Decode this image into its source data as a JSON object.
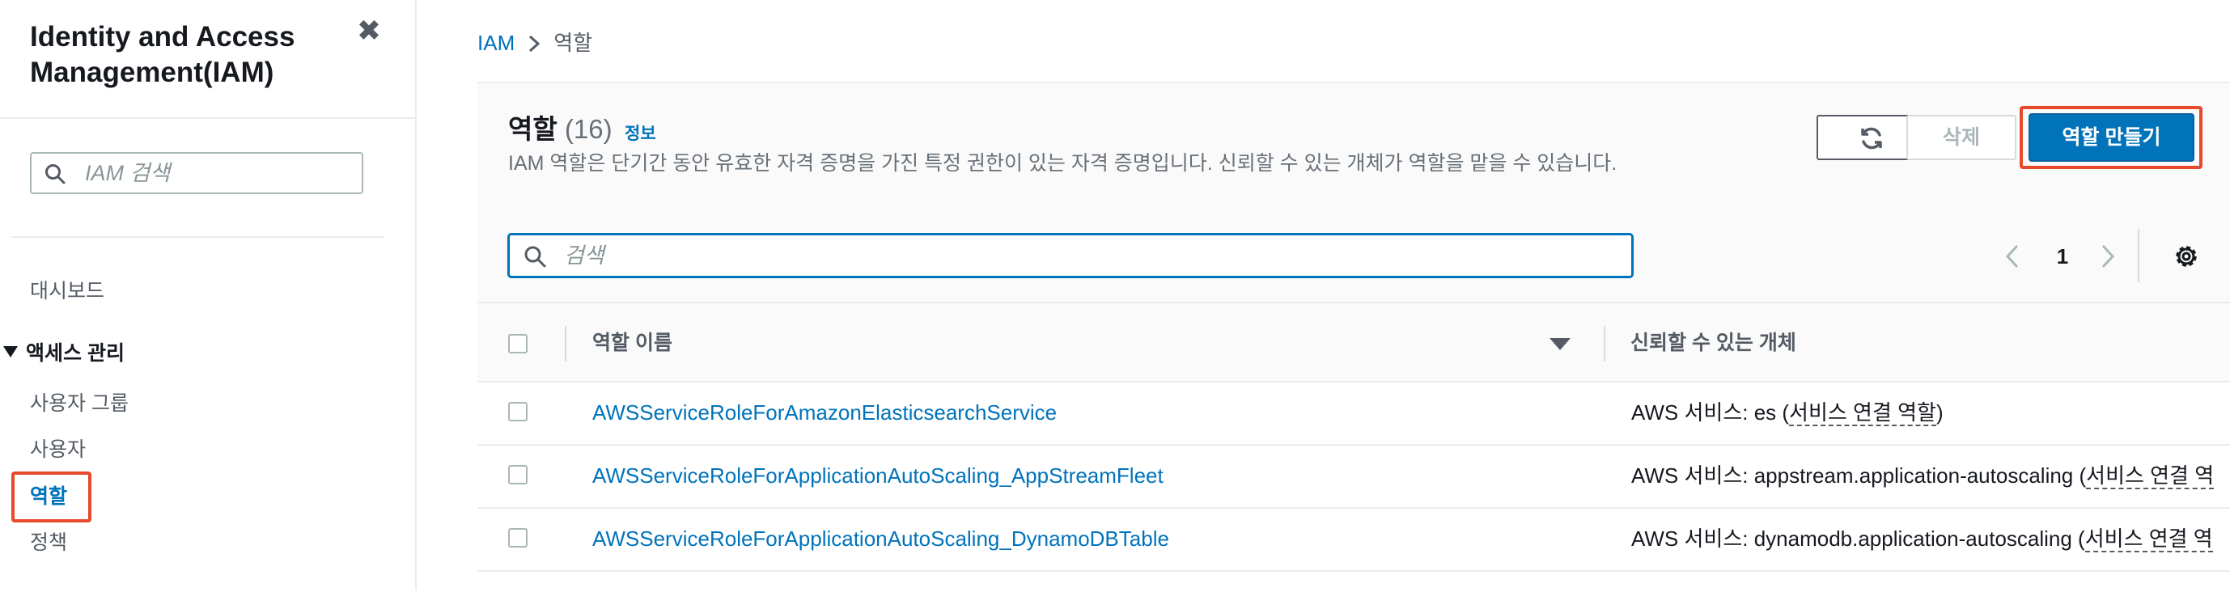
{
  "sidebar": {
    "title": "Identity and Access Management(IAM)",
    "close_glyph": "✖",
    "search_placeholder": "IAM 검색",
    "dashboard_label": "대시보드",
    "access_section_label": "액세스 관리",
    "items": [
      {
        "label": "사용자 그룹"
      },
      {
        "label": "사용자"
      },
      {
        "label": "역할",
        "active": true
      },
      {
        "label": "정책"
      }
    ]
  },
  "breadcrumb": {
    "root": "IAM",
    "separator": ">",
    "current": "역할"
  },
  "header": {
    "title": "역할",
    "count": "(16)",
    "info_link": "정보",
    "description": "IAM 역할은 단기간 동안 유효한 자격 증명을 가진 특정 권한이 있는 자격 증명입니다. 신뢰할 수 있는 개체가 역할을 맡을 수 있습니다.",
    "delete_label": "삭제",
    "create_label": "역할 만들기"
  },
  "search": {
    "placeholder": "검색"
  },
  "pagination": {
    "current_page": "1"
  },
  "table": {
    "columns": [
      "역할 이름",
      "신뢰할 수 있는 개체"
    ],
    "rows": [
      {
        "name": "AWSServiceRoleForAmazonElasticsearchService",
        "trust_prefix": "AWS 서비스: es (",
        "trust_link": "서비스 연결 역할",
        "trust_suffix": ")"
      },
      {
        "name": "AWSServiceRoleForApplicationAutoScaling_AppStreamFleet",
        "trust_prefix": "AWS 서비스: appstream.application-autoscaling (",
        "trust_link": "서비스 연결 역",
        "trust_suffix": ""
      },
      {
        "name": "AWSServiceRoleForApplicationAutoScaling_DynamoDBTable",
        "trust_prefix": "AWS 서비스: dynamodb.application-autoscaling (",
        "trust_link": "서비스 연결 역",
        "trust_suffix": ""
      }
    ]
  },
  "colors": {
    "link": "#0073bb",
    "primary_button": "#0073bb",
    "highlight_border": "#e8492a"
  }
}
